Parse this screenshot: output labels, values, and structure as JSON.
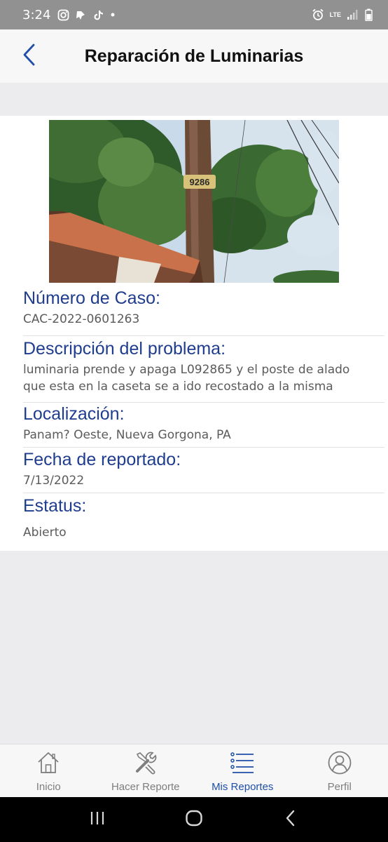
{
  "status_bar": {
    "time": "3:24",
    "network": "LTE",
    "icons": [
      "instagram-icon",
      "pin-icon",
      "tiktok-icon",
      "dot-icon",
      "alarm-icon",
      "signal-icon",
      "battery-icon"
    ]
  },
  "header": {
    "title": "Reparación de Luminarias",
    "back_icon": "chevron-left-icon"
  },
  "report": {
    "case_number": {
      "label": "Número de Caso:",
      "value": "CAC-2022-0601263"
    },
    "description": {
      "label": "Descripción del problema:",
      "line1": "luminaria prende y apaga L092865 y el poste de alado",
      "line2": "que esta en la caseta se a ido recostado a la misma"
    },
    "location": {
      "label": "Localización:",
      "value": "Panam? Oeste, Nueva Gorgona, PA"
    },
    "reported_date": {
      "label": "Fecha de reportado:",
      "value": "7/13/2022"
    },
    "status": {
      "label": "Estatus:",
      "value": "Abierto"
    },
    "photo_tag": "9286"
  },
  "tabs": [
    {
      "label": "Inicio",
      "icon": "home-icon"
    },
    {
      "label": "Hacer Reporte",
      "icon": "tools-icon"
    },
    {
      "label": "Mis Reportes",
      "icon": "list-icon",
      "active": true
    },
    {
      "label": "Perfil",
      "icon": "user-icon"
    }
  ],
  "colors": {
    "accent": "#1f4fa8",
    "label_blue": "#1f3d8e",
    "status_bar": "#919191"
  }
}
